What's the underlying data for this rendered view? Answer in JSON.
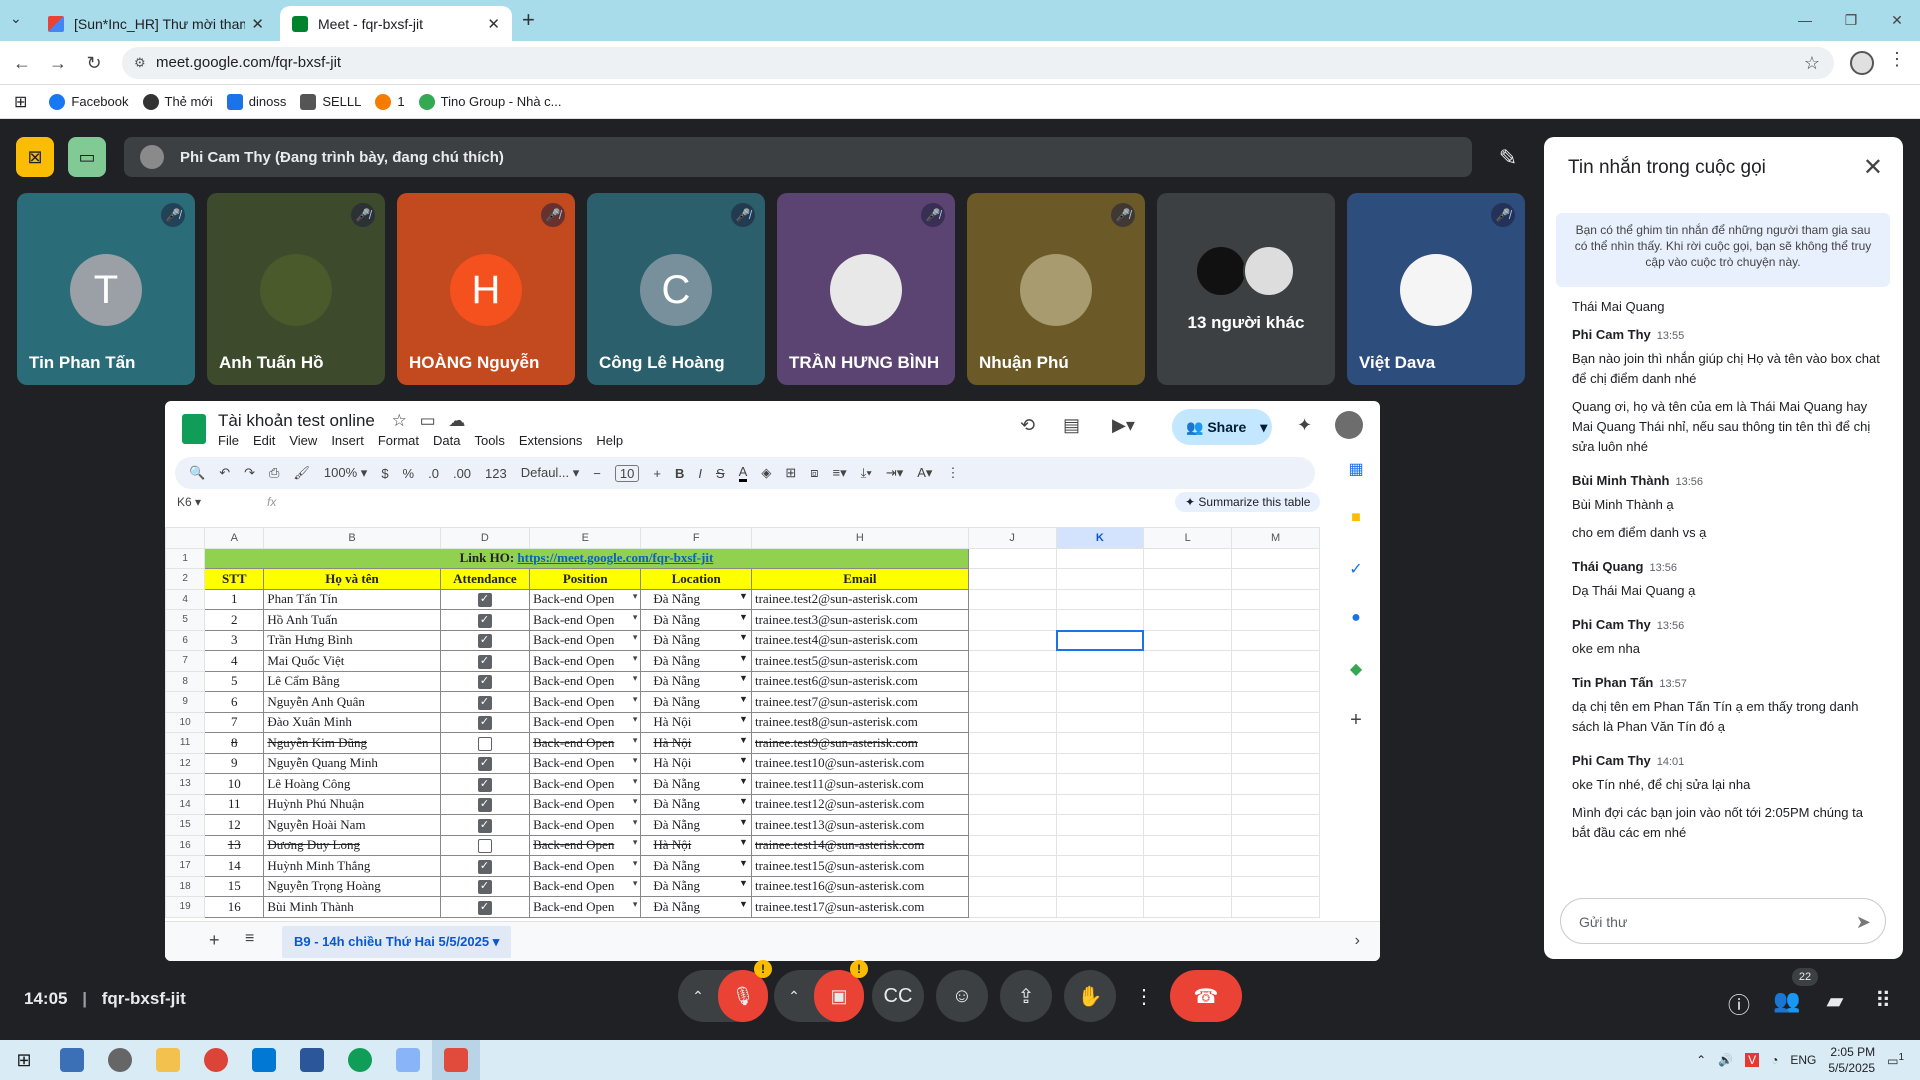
{
  "browser": {
    "tabs": [
      {
        "label": "[Sun*Inc_HR] Thư mời tham dự",
        "icon": "gmail-icon"
      },
      {
        "label": "Meet - fqr-bxsf-jit",
        "icon": "meet-icon"
      }
    ],
    "url": "meet.google.com/fqr-bxsf-jit",
    "bookmarks": [
      "Facebook",
      "Thẻ mới",
      "dinoss",
      "SELLL",
      "1",
      "Tino Group - Nhà c..."
    ]
  },
  "presentation": {
    "presenter": "Phi Cam Thy (Đang trình bày, đang chú thích)"
  },
  "participants": [
    {
      "name": "Tin Phan Tấn",
      "initial": "T",
      "bg": "#2a6d78",
      "circle": "#9aa0a6"
    },
    {
      "name": "Anh Tuấn Hồ",
      "initial": "",
      "bg": "#3e4a2c",
      "circle": "#4a5a2a"
    },
    {
      "name": "HOÀNG Nguyễn",
      "initial": "H",
      "bg": "#c24a1e",
      "circle": "#f4511e"
    },
    {
      "name": "Công Lê Hoàng",
      "initial": "C",
      "bg": "#2b5f6c",
      "circle": "#78909c"
    },
    {
      "name": "TRẦN HƯNG BÌNH",
      "initial": "",
      "bg": "#5b4471",
      "circle": "#e8e8e8"
    },
    {
      "name": "Nhuận Phú",
      "initial": "",
      "bg": "#6b5a28",
      "circle": "#a89b70"
    },
    {
      "name": "13 người khác",
      "initial": "",
      "bg": "#3c4043",
      "circle": ""
    },
    {
      "name": "Việt Dava",
      "initial": "",
      "bg": "#2d4d7d",
      "circle": "#f5f5f5"
    }
  ],
  "sheet": {
    "title": "Tài khoản test online",
    "menus": [
      "File",
      "Edit",
      "View",
      "Insert",
      "Format",
      "Data",
      "Tools",
      "Extensions",
      "Help"
    ],
    "share": "Share",
    "toolbar": {
      "zoom": "100%",
      "currency": "$",
      "percent": "%",
      "dec_less": ".0",
      "dec_more": ".00",
      "num": "123",
      "font": "Defaul...",
      "size": "10"
    },
    "namebox": "K6",
    "fx": "fx",
    "summarize": "Summarize this table",
    "columns": [
      "A",
      "B",
      "",
      "D",
      "E",
      "F",
      "",
      "H",
      "",
      "J",
      "K",
      "L",
      "M"
    ],
    "link_label": "Link HO: ",
    "link_url": "https://meet.google.com/fqr-bxsf-jit",
    "headers": [
      "STT",
      "Họ và tên",
      "Attendance",
      "Position",
      "Location",
      "Email"
    ],
    "rows": [
      {
        "rn": "4",
        "stt": "1",
        "name": "Phan Tấn Tín",
        "att": true,
        "pos": "Back-end Open",
        "loc": "Đà Nẵng",
        "email": "trainee.test2@sun-asterisk.com",
        "strike": false
      },
      {
        "rn": "5",
        "stt": "2",
        "name": "Hồ Anh Tuấn",
        "att": true,
        "pos": "Back-end Open",
        "loc": "Đà Nẵng",
        "email": "trainee.test3@sun-asterisk.com",
        "strike": false
      },
      {
        "rn": "6",
        "stt": "3",
        "name": "Trần Hưng Bình",
        "att": true,
        "pos": "Back-end Open",
        "loc": "Đà Nẵng",
        "email": "trainee.test4@sun-asterisk.com",
        "strike": false
      },
      {
        "rn": "7",
        "stt": "4",
        "name": "Mai Quốc Việt",
        "att": true,
        "pos": "Back-end Open",
        "loc": "Đà Nẵng",
        "email": "trainee.test5@sun-asterisk.com",
        "strike": false
      },
      {
        "rn": "8",
        "stt": "5",
        "name": "Lê Cẩm Bằng",
        "att": true,
        "pos": "Back-end Open",
        "loc": "Đà Nẵng",
        "email": "trainee.test6@sun-asterisk.com",
        "strike": false
      },
      {
        "rn": "9",
        "stt": "6",
        "name": "Nguyễn Anh Quân",
        "att": true,
        "pos": "Back-end Open",
        "loc": "Đà Nẵng",
        "email": "trainee.test7@sun-asterisk.com",
        "strike": false
      },
      {
        "rn": "10",
        "stt": "7",
        "name": "Đào Xuân Minh",
        "att": true,
        "pos": "Back-end Open",
        "loc": "Hà Nội",
        "email": "trainee.test8@sun-asterisk.com",
        "strike": false
      },
      {
        "rn": "11",
        "stt": "8",
        "name": "Nguyễn Kim Dũng",
        "att": false,
        "pos": "Back-end Open",
        "loc": "Hà Nội",
        "email": "trainee.test9@sun-asterisk.com",
        "strike": true
      },
      {
        "rn": "12",
        "stt": "9",
        "name": "Nguyễn Quang Minh",
        "att": true,
        "pos": "Back-end Open",
        "loc": "Hà Nội",
        "email": "trainee.test10@sun-asterisk.com",
        "strike": false
      },
      {
        "rn": "13",
        "stt": "10",
        "name": "Lê Hoàng Công",
        "att": true,
        "pos": "Back-end Open",
        "loc": "Đà Nẵng",
        "email": "trainee.test11@sun-asterisk.com",
        "strike": false
      },
      {
        "rn": "14",
        "stt": "11",
        "name": "Huỳnh Phú Nhuận",
        "att": true,
        "pos": "Back-end Open",
        "loc": "Đà Nẵng",
        "email": "trainee.test12@sun-asterisk.com",
        "strike": false
      },
      {
        "rn": "15",
        "stt": "12",
        "name": "Nguyễn Hoài Nam",
        "att": true,
        "pos": "Back-end Open",
        "loc": "Đà Nẵng",
        "email": "trainee.test13@sun-asterisk.com",
        "strike": false
      },
      {
        "rn": "16",
        "stt": "13",
        "name": "Dương Duy Long",
        "att": false,
        "pos": "Back-end Open",
        "loc": "Hà Nội",
        "email": "trainee.test14@sun-asterisk.com",
        "strike": true
      },
      {
        "rn": "17",
        "stt": "14",
        "name": "Huỳnh Minh Thắng",
        "att": true,
        "pos": "Back-end Open",
        "loc": "Đà Nẵng",
        "email": "trainee.test15@sun-asterisk.com",
        "strike": false
      },
      {
        "rn": "18",
        "stt": "15",
        "name": "Nguyễn Trọng Hoàng",
        "att": true,
        "pos": "Back-end Open",
        "loc": "Đà Nẵng",
        "email": "trainee.test16@sun-asterisk.com",
        "strike": false
      },
      {
        "rn": "19",
        "stt": "16",
        "name": "Bùi Minh Thành",
        "att": true,
        "pos": "Back-end Open",
        "loc": "Đà Nẵng",
        "email": "trainee.test17@sun-asterisk.com",
        "strike": false
      }
    ],
    "active_tab": "B9 - 14h chiều Thứ Hai 5/5/2025"
  },
  "chat": {
    "title": "Tin nhắn trong cuộc gọi",
    "info": "Bạn có thể ghim tin nhắn để những người tham gia sau có thể nhìn thấy. Khi rời cuộc gọi, bạn sẽ không thể truy cập vào cuộc trò chuyện này.",
    "top_fragment": "Thái Mai Quang",
    "messages": [
      {
        "sender": "Phi Cam Thy",
        "time": "13:55",
        "lines": [
          "Bạn nào join thì nhắn giúp chị Họ và tên vào box chat để chị điểm danh nhé",
          "Quang ơi, họ và tên của em là Thái Mai Quang hay Mai Quang Thái nhỉ, nếu sau thông tin tên thì để chị sửa luôn nhé"
        ]
      },
      {
        "sender": "Bùi Minh Thành",
        "time": "13:56",
        "lines": [
          "Bùi Minh Thành ạ",
          "cho em điểm danh vs ạ"
        ]
      },
      {
        "sender": "Thái Quang",
        "time": "13:56",
        "lines": [
          "Dạ Thái Mai Quang ạ"
        ]
      },
      {
        "sender": "Phi Cam Thy",
        "time": "13:56",
        "lines": [
          "oke em nha"
        ]
      },
      {
        "sender": "Tin Phan Tấn",
        "time": "13:57",
        "lines": [
          "dạ chị tên em Phan Tấn Tín ạ  em thấy trong danh sách là Phan Văn Tín đó ạ"
        ]
      },
      {
        "sender": "Phi Cam Thy",
        "time": "14:01",
        "lines": [
          "oke Tín nhé, để chị sửa lại nha",
          "Mình đợi các bạn join vào nốt tới 2:05PM chúng ta bắt đầu các em nhé"
        ]
      }
    ],
    "input_placeholder": "Gửi thư"
  },
  "controls": {
    "time": "14:05",
    "meeting_code": "fqr-bxsf-jit",
    "participant_count": "22"
  },
  "taskbar": {
    "lang": "ENG",
    "time": "2:05 PM",
    "date": "5/5/2025",
    "notif": "1"
  },
  "colors": {
    "meet_bg": "#202124",
    "end_call": "#ea4335",
    "share": "#c2e7ff",
    "link_row": "#92d050",
    "header_row": "#ffff00"
  }
}
